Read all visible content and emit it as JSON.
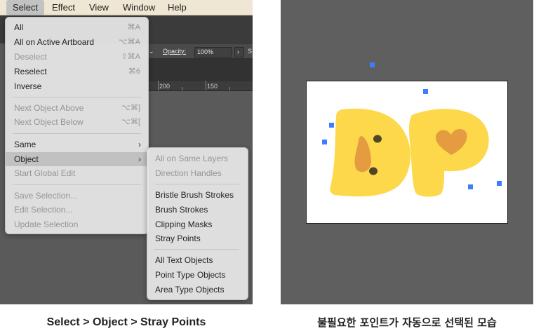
{
  "menubar": {
    "items": [
      "Select",
      "Effect",
      "View",
      "Window",
      "Help"
    ],
    "active": "Select"
  },
  "control_bar": {
    "opacity_label": "Opacity:",
    "opacity_value": "100%",
    "partial_label": "S"
  },
  "ruler": {
    "labels": [
      "200",
      "150"
    ]
  },
  "select_menu": {
    "items": [
      {
        "label": "All",
        "shortcut": "⌘A",
        "enabled": true
      },
      {
        "label": "All on Active Artboard",
        "shortcut": "⌥⌘A",
        "enabled": true
      },
      {
        "label": "Deselect",
        "shortcut": "⇧⌘A",
        "enabled": false
      },
      {
        "label": "Reselect",
        "shortcut": "⌘6",
        "enabled": true
      },
      {
        "label": "Inverse",
        "shortcut": "",
        "enabled": true
      },
      {
        "label": "Next Object Above",
        "shortcut": "⌥⌘]",
        "enabled": false
      },
      {
        "label": "Next Object Below",
        "shortcut": "⌥⌘[",
        "enabled": false
      },
      {
        "label": "Same",
        "shortcut": "",
        "enabled": true,
        "submenu": true
      },
      {
        "label": "Object",
        "shortcut": "",
        "enabled": true,
        "submenu": true,
        "highlighted": true
      },
      {
        "label": "Start Global Edit",
        "shortcut": "",
        "enabled": false
      },
      {
        "label": "Save Selection...",
        "shortcut": "",
        "enabled": false
      },
      {
        "label": "Edit Selection...",
        "shortcut": "",
        "enabled": false
      },
      {
        "label": "Update Selection",
        "shortcut": "",
        "enabled": false
      }
    ]
  },
  "object_submenu": {
    "items": [
      {
        "label": "All on Same Layers",
        "enabled": false
      },
      {
        "label": "Direction Handles",
        "enabled": false
      },
      {
        "label": "Bristle Brush Strokes",
        "enabled": true
      },
      {
        "label": "Brush Strokes",
        "enabled": true
      },
      {
        "label": "Clipping Masks",
        "enabled": true
      },
      {
        "label": "Stray Points",
        "enabled": true
      },
      {
        "label": "All Text Objects",
        "enabled": true
      },
      {
        "label": "Point Type Objects",
        "enabled": true
      },
      {
        "label": "Area Type Objects",
        "enabled": true
      }
    ]
  },
  "canvas": {
    "colors": {
      "letter_fill": "#fcd84a",
      "accent_fill": "#e59b3f",
      "eye_fill": "#4f4527",
      "anchor": "#3d7dff"
    },
    "stray_point_count": 7
  },
  "captions": {
    "left": "Select > Object > Stray Points",
    "right": "불필요한 포인트가 자동으로 선택된 모습"
  }
}
